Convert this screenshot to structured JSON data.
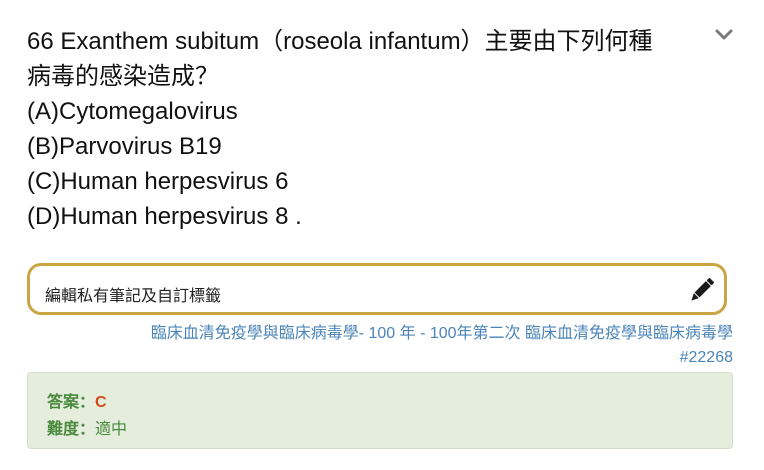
{
  "question": {
    "line1": "66 Exanthem subitum（roseola infantum）主要由下列何種",
    "line2": "病毒的感染造成？",
    "options": [
      "(A)Cytomegalovirus",
      "(B)Parvovirus B19",
      "(C)Human herpesvirus 6",
      "(D)Human herpesvirus 8 ."
    ]
  },
  "icons": {
    "expand": "chevron-down-icon",
    "edit": "pencil-icon"
  },
  "note": {
    "label": "編輯私有筆記及自訂標籤"
  },
  "source": {
    "exam_link": "臨床血清免疫學與臨床病毒學- 100 年 - 100年第二次 臨床血清免疫學與臨床病毒學",
    "id_link": "#22268"
  },
  "answer": {
    "answer_label": "答案：",
    "answer_value": "C",
    "difficulty_label": "難度：",
    "difficulty_value": "適中"
  },
  "colors": {
    "note_border": "#c9a544",
    "link": "#4a84b8",
    "answer_bg": "#e5eedd",
    "label_green": "#4c8a3f",
    "answer_red": "#d24a1a"
  }
}
